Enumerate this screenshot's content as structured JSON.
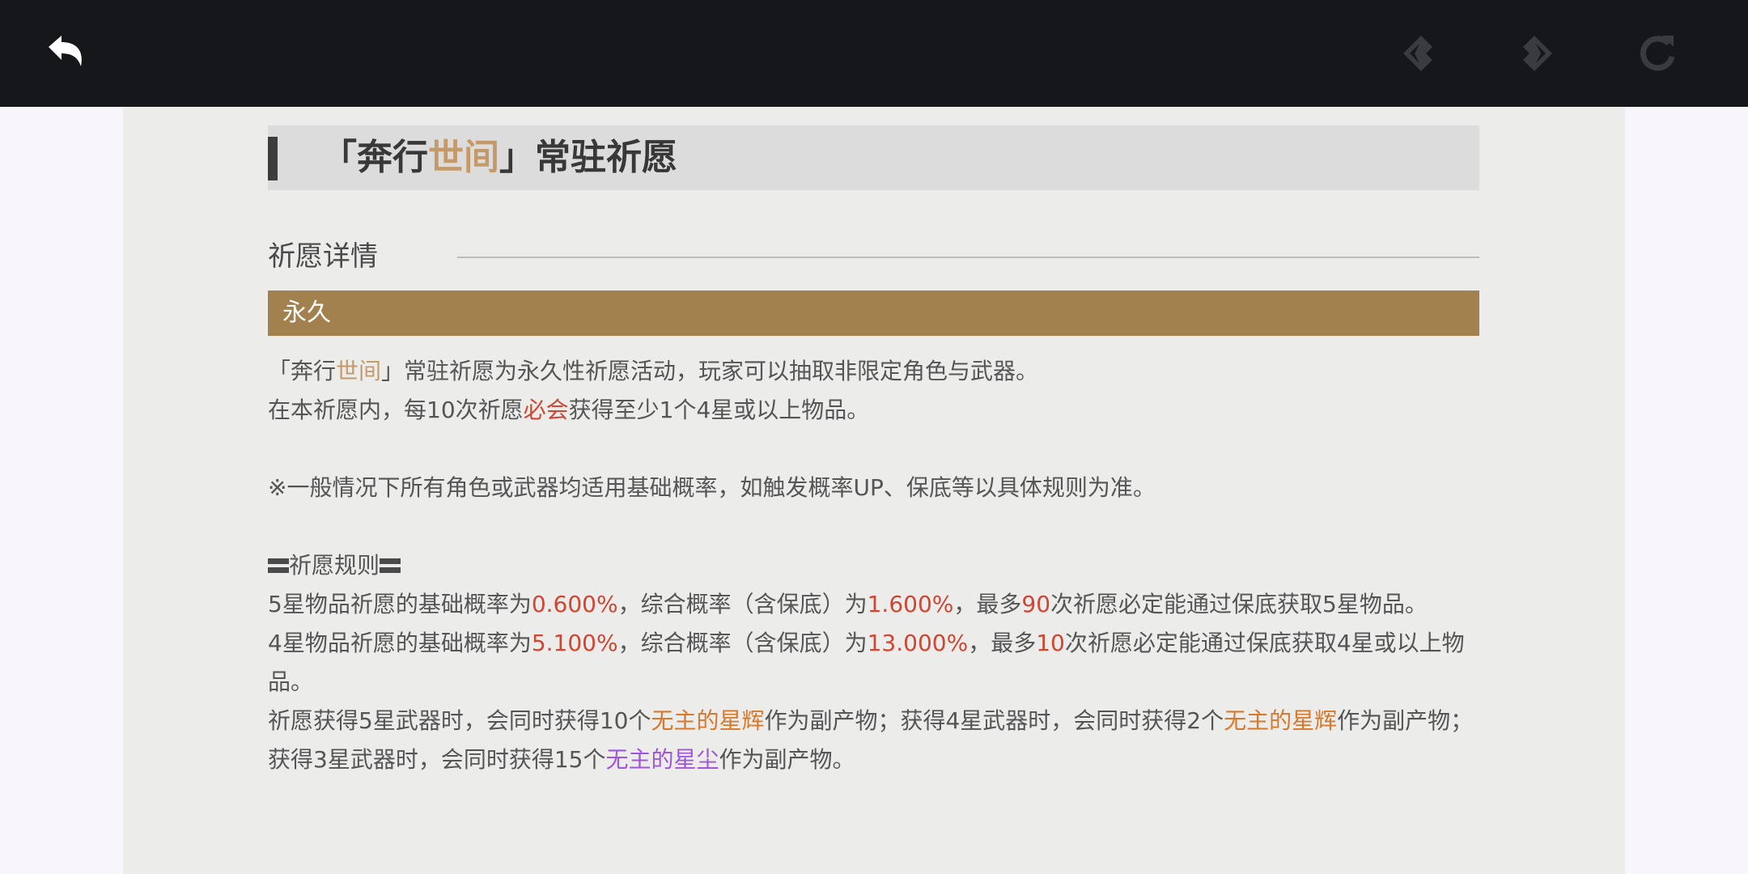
{
  "toolbar": {
    "back_icon": "back-arrow-icon",
    "prev_icon": "previous-icon",
    "next_icon": "next-icon",
    "refresh_icon": "refresh-icon"
  },
  "title": {
    "open": "「奔行",
    "highlight": "世间",
    "close": "」常驻祈愿"
  },
  "section": {
    "label": "祈愿详情"
  },
  "duration": "永久",
  "body": {
    "line1_a": "「奔行",
    "line1_b": "世间",
    "line1_c": "」常驻祈愿为永久性祈愿活动，玩家可以抽取非限定角色与武器。",
    "line2_a": "在本祈愿内，每10次祈愿",
    "line2_b": "必会",
    "line2_c": "获得至少1个4星或以上物品。",
    "note": "※一般情况下所有角色或武器均适用基础概率，如触发概率UP、保底等以具体规则为准。",
    "rules_title": "祈愿规则",
    "r5_a": "5星物品祈愿的基础概率为",
    "r5_b": "0.600%",
    "r5_c": "，综合概率（含保底）为",
    "r5_d": "1.600%",
    "r5_e": "，最多",
    "r5_f": "90",
    "r5_g": "次祈愿必定能通过保底获取5星物品。",
    "r4_a": "4星物品祈愿的基础概率为",
    "r4_b": "5.100%",
    "r4_c": "，综合概率（含保底）为",
    "r4_d": "13.000%",
    "r4_e": "，最多",
    "r4_f": "10",
    "r4_g": "次祈愿必定能通过保底获取4星或以上物品。",
    "bp_a": "祈愿获得5星武器时，会同时获得10个",
    "bp_b": "无主的星辉",
    "bp_c": "作为副产物；获得4星武器时，会同时获得2个",
    "bp_d": "无主的星辉",
    "bp_e": "作为副产物；获得3星武器时，会同时获得15个",
    "bp_f": "无主的星尘",
    "bp_g": "作为副产物。"
  },
  "colors": {
    "topbar": "#16171b",
    "gold": "#c59a6b",
    "duration_bar": "#a3814f",
    "red": "#cf4633",
    "orange": "#d7792d",
    "purple": "#a055dd"
  }
}
